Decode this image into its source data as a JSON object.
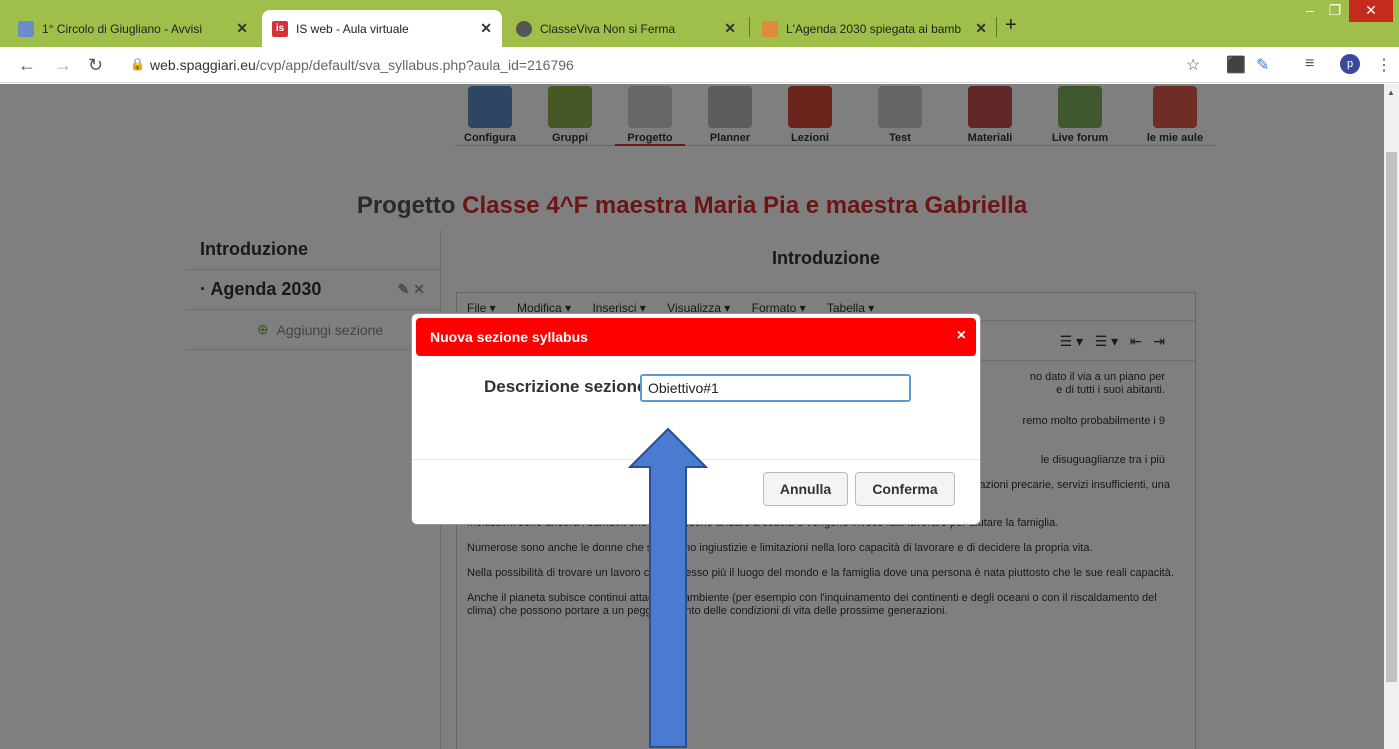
{
  "browser": {
    "tabs": [
      {
        "label": "1° Circolo di Giugliano - Avvisi",
        "close": "✕"
      },
      {
        "label": "IS web - Aula virtuale",
        "close": "✕"
      },
      {
        "label": "ClasseViva Non si Ferma",
        "close": "✕"
      },
      {
        "label": "L'Agenda 2030 spiegata ai bamb",
        "close": "✕"
      }
    ],
    "new_tab": "+",
    "url_host": "web.spaggiari.eu",
    "url_path": "/cvp/app/default/sva_syllabus.php?aula_id=216796",
    "profile_initial": "p"
  },
  "toolbar": {
    "items": [
      "Configura",
      "Gruppi",
      "Progetto",
      "Planner",
      "Lezioni",
      "Test",
      "Materiali",
      "Live forum",
      "le mie aule"
    ]
  },
  "page": {
    "title_prefix": "Progetto",
    "title_name": "Classe 4^F maestra Maria Pia e maestra Gabriella"
  },
  "sidebar": {
    "intro": "Introduzione",
    "section": "· Agenda 2030",
    "add_section": "Aggiungi sezione"
  },
  "main": {
    "header": "Introduzione",
    "menu": [
      "File ▾",
      "Modifica ▾",
      "Inserisci ▾",
      "Visualizza ▾",
      "Formato ▾",
      "Tabella ▾"
    ],
    "content": [
      "no dato il via a un piano per",
      "e di tutti i suoi abitanti.",
      "remo molto probabilmente i 9",
      "le disuguaglianze tra i più",
      "Per esempio, più di un miliardo di persone vive in situazione di povertà: poco cibo o di scarsa qualità, abitazioni precarie, servizi insufficienti, una scarsa possibilità di prevenire e curare le malattie.",
      "Moltissimi sono ancora i bambini che non possono andare a scuola e vengono invece fatti lavorare per aiutare la famiglia.",
      "Numerose sono anche le donne che subiscono ingiustizie e limitazioni nella loro capacità di lavorare e di decidere la propria vita.",
      "Nella possibilità di trovare un lavoro conta spesso più il luogo del mondo e la famiglia dove una persona è nata piuttosto che le sue reali capacità.",
      "Anche il pianeta subisce continui attacchi all'ambiente (per esempio con l'inquinamento dei continenti e degli oceani o con il riscaldamento del clima) che possono portare a un peggioramento delle condizioni di vita delle prossime generazioni."
    ]
  },
  "modal": {
    "title": "Nuova sezione syllabus",
    "close": "×",
    "label": "Descrizione sezione",
    "input_value": "Obiettivo#1",
    "cancel": "Annulla",
    "confirm": "Conferma"
  },
  "colors": {
    "tabbar": "#9fbf4a",
    "modal_header": "#ff0000",
    "title_red": "#d62b2b",
    "arrow_fill": "#4a7bd0"
  }
}
